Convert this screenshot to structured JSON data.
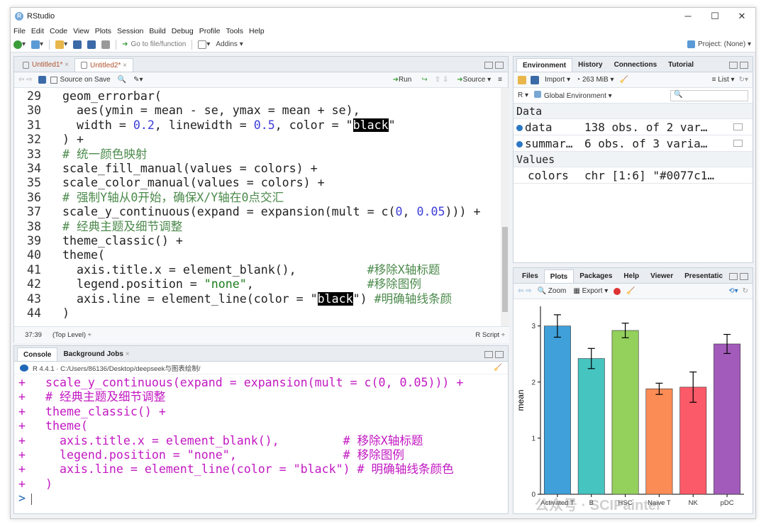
{
  "window": {
    "title": "RStudio",
    "controls": [
      "─",
      "☐",
      "✕"
    ]
  },
  "menu": [
    "File",
    "Edit",
    "Code",
    "View",
    "Plots",
    "Session",
    "Build",
    "Debug",
    "Profile",
    "Tools",
    "Help"
  ],
  "toolbar": {
    "goto_placeholder": "Go to file/function",
    "addins": "Addins",
    "project": "Project: (None)"
  },
  "editor": {
    "tabs": [
      "Untitled1*",
      "Untitled2*"
    ],
    "source_on_save": "Source on Save",
    "run": "Run",
    "source": "Source",
    "status_pos": "37:39",
    "status_scope": "(Top Level) ÷",
    "status_type": "R Script ÷",
    "lines": [
      {
        "n": "29",
        "text": "  geom_errorbar("
      },
      {
        "n": "30",
        "text": "    aes(ymin = mean - se, ymax = mean + se),"
      },
      {
        "n": "31",
        "text": "    width = 0.2, linewidth = 0.5, color = \"black\""
      },
      {
        "n": "32",
        "text": "  ) +"
      },
      {
        "n": "33",
        "text": "  # 统一颜色映射"
      },
      {
        "n": "34",
        "text": "  scale_fill_manual(values = colors) +"
      },
      {
        "n": "35",
        "text": "  scale_color_manual(values = colors) +"
      },
      {
        "n": "36",
        "text": "  # 强制Y轴从0开始，确保X/Y轴在0点交汇"
      },
      {
        "n": "37",
        "text": "  scale_y_continuous(expand = expansion(mult = c(0, 0.05))) +"
      },
      {
        "n": "38",
        "text": "  # 经典主题及细节调整"
      },
      {
        "n": "39",
        "text": "  theme_classic() +"
      },
      {
        "n": "40",
        "text": "  theme("
      },
      {
        "n": "41",
        "text": "    axis.title.x = element_blank(),          # 移除X轴标题"
      },
      {
        "n": "42",
        "text": "    legend.position = \"none\",                # 移除图例"
      },
      {
        "n": "43",
        "text": "    axis.line = element_line(color = \"black\") # 明确轴线条颜"
      },
      {
        "n": "44",
        "text": "  )"
      }
    ]
  },
  "console": {
    "tabs": [
      "Console",
      "Background Jobs"
    ],
    "path": "R 4.4.1 · C:/Users/86136/Desktop/deepseek与图表绘制/",
    "lines": [
      "  scale_y_continuous(expand = expansion(mult = c(0, 0.05))) +",
      "  # 经典主题及细节调整",
      "  theme_classic() +",
      "  theme(",
      "    axis.title.x = element_blank(),         # 移除X轴标题",
      "    legend.position = \"none\",               # 移除图例",
      "    axis.line = element_line(color = \"black\") # 明确轴线条颜色",
      "  )"
    ],
    "prompt": ">"
  },
  "environment": {
    "tabs": [
      "Environment",
      "History",
      "Connections",
      "Tutorial"
    ],
    "import": "Import",
    "memory": "263 MiB",
    "list": "List",
    "r_label": "R",
    "global_env": "Global Environment",
    "data_header": "Data",
    "values_header": "Values",
    "rows": [
      {
        "name": "data",
        "value": "138 obs. of 2 var…"
      },
      {
        "name": "summar…",
        "value": "6 obs. of 3 varia…"
      }
    ],
    "values": [
      {
        "name": "colors",
        "value": "chr [1:6] \"#0077c1…"
      }
    ]
  },
  "plots_pane": {
    "tabs": [
      "Files",
      "Plots",
      "Packages",
      "Help",
      "Viewer",
      "Presentatic"
    ],
    "zoom": "Zoom",
    "export": "Export",
    "watermark": "公众号 · SCIPainter"
  },
  "chart_data": {
    "type": "bar",
    "categories": [
      "Activated T",
      "B",
      "HSC",
      "Naive T",
      "NK",
      "pDC"
    ],
    "values": [
      3.0,
      2.42,
      2.92,
      1.88,
      1.91,
      2.68
    ],
    "errors": [
      0.2,
      0.18,
      0.13,
      0.1,
      0.27,
      0.17
    ],
    "colors": [
      "#3fa0da",
      "#46c4c0",
      "#93d05c",
      "#fb8c55",
      "#fb5a68",
      "#a25bbb"
    ],
    "ylabel": "mean",
    "xlabel": "",
    "ylim": [
      0,
      3.35
    ],
    "yticks": [
      0,
      1,
      2,
      3
    ]
  }
}
